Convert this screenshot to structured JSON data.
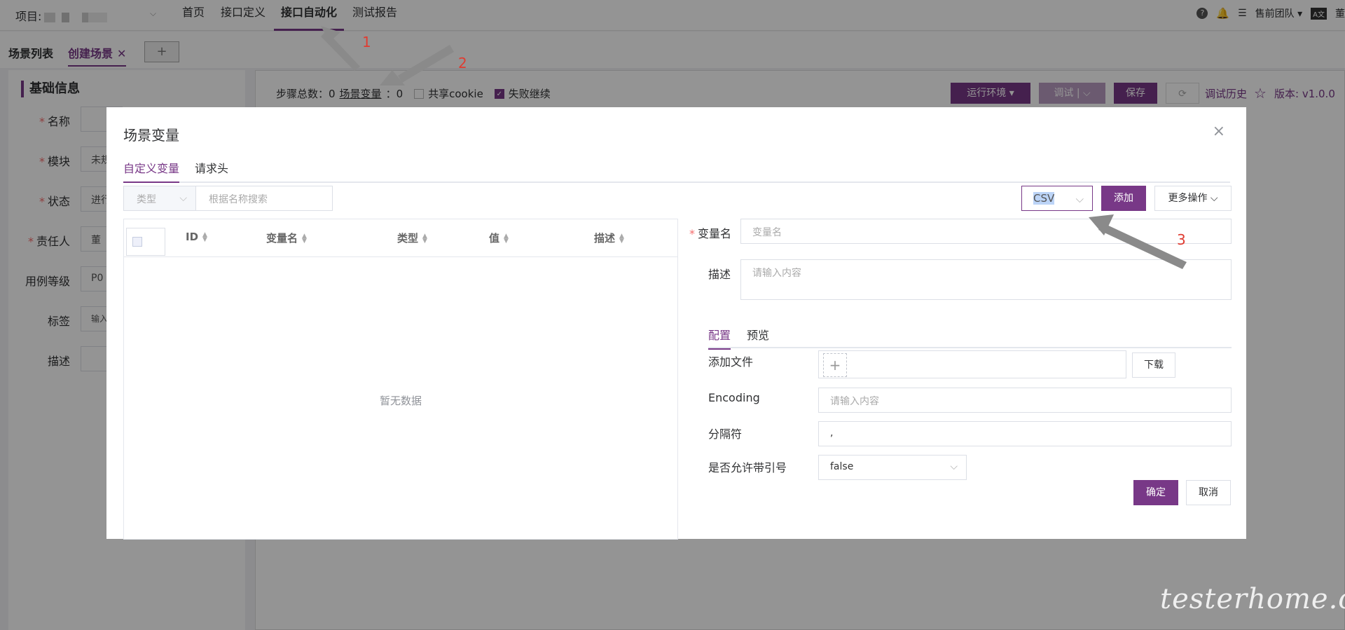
{
  "topbar": {
    "project_label": "项目:",
    "nav": [
      "首页",
      "接口定义",
      "接口自动化",
      "测试报告"
    ],
    "team": "售前团队",
    "cut_label": "董"
  },
  "tabs": {
    "list": "场景列表",
    "create": "创建场景",
    "close": "✕",
    "add": "+"
  },
  "basic_info": {
    "title": "基础信息",
    "fields": [
      {
        "label": "名称",
        "value": "",
        "required": true
      },
      {
        "label": "模块",
        "value": "未规",
        "required": true
      },
      {
        "label": "状态",
        "value": "进行",
        "required": true
      },
      {
        "label": "责任人",
        "value": "董",
        "required": true
      },
      {
        "label": "用例等级",
        "value": "P0",
        "required": false
      },
      {
        "label": "标签",
        "value": "输入标",
        "required": false
      },
      {
        "label": "描述",
        "value": "",
        "required": false
      }
    ]
  },
  "stepbar": {
    "steps_label": "步骤总数：0",
    "vars_label": "场景变量",
    "vars_count": "：0",
    "share_cookie": "共享cookie",
    "fail_continue": "失败继续",
    "env_btn": "运行环境",
    "debug_btn": "调试",
    "save_btn": "保存",
    "history": "调试历史",
    "version": "版本: v1.0.0"
  },
  "modal": {
    "title": "场景变量",
    "tabs": [
      "自定义变量",
      "请求头"
    ],
    "type_placeholder": "类型",
    "search_placeholder": "根据名称搜索",
    "csv_value": "CSV",
    "add_btn": "添加",
    "more_btn": "更多操作",
    "columns": [
      "ID",
      "变量名",
      "类型",
      "值",
      "描述"
    ],
    "empty_text": "暂无数据",
    "var_name_label": "变量名",
    "var_name_placeholder": "变量名",
    "desc_label": "描述",
    "desc_placeholder": "请输入内容",
    "sub_tabs": [
      "配置",
      "预览"
    ],
    "add_file_label": "添加文件",
    "download_btn": "下载",
    "encoding_label": "Encoding",
    "encoding_placeholder": "请输入内容",
    "delimiter_label": "分隔符",
    "delimiter_value": ",",
    "quote_label": "是否允许带引号",
    "quote_value": "false",
    "ok_btn": "确定",
    "cancel_btn": "取消"
  },
  "annotations": [
    "1",
    "2",
    "3"
  ],
  "watermark": "testerhome.com",
  "colors": {
    "accent": "#783887",
    "required": "#f56c6c",
    "annotation": "#e03c31"
  }
}
